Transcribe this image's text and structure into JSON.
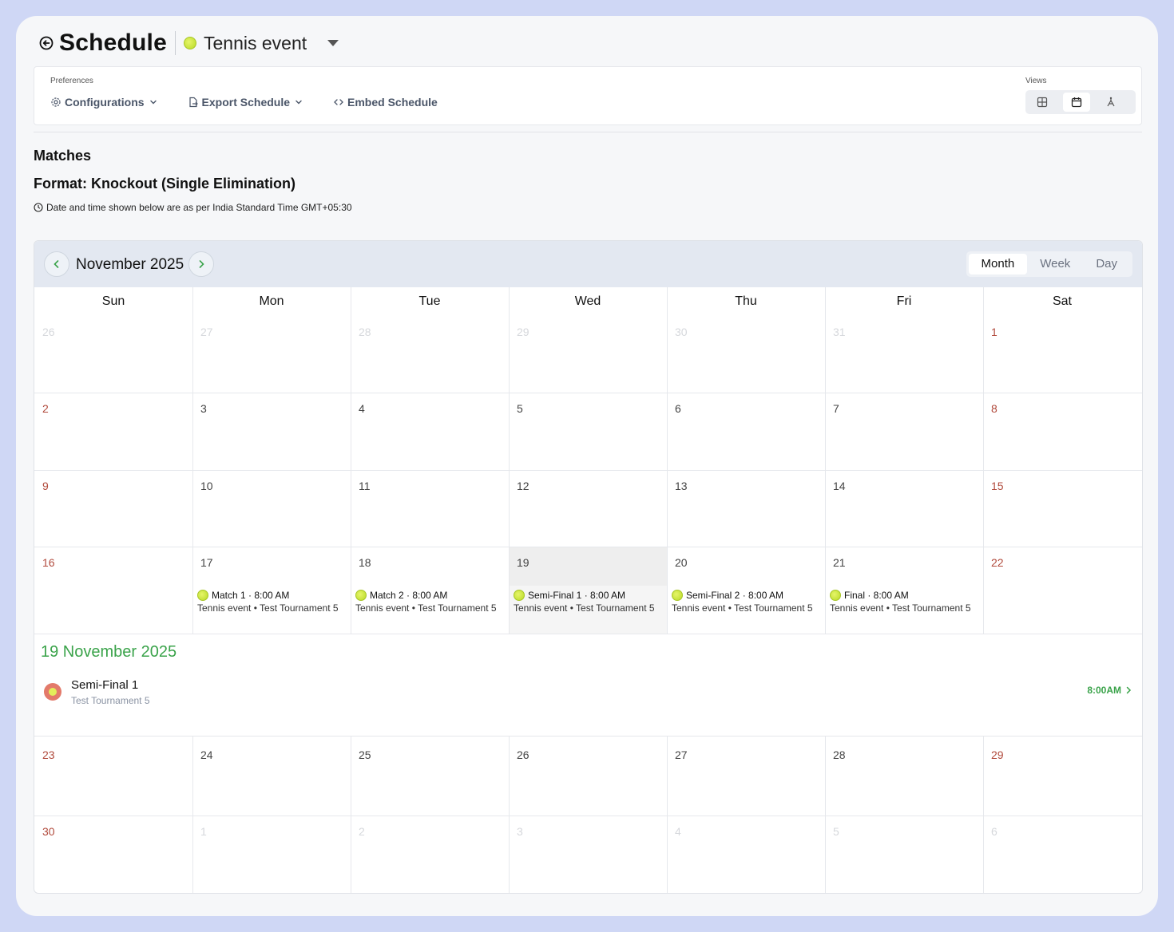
{
  "header": {
    "title": "Schedule",
    "event_name": "Tennis event"
  },
  "preferences": {
    "label": "Preferences",
    "configurations": "Configurations",
    "export": "Export Schedule",
    "embed": "Embed Schedule",
    "views_label": "Views"
  },
  "section": {
    "title": "Matches",
    "format": "Format: Knockout (Single Elimination)",
    "timezone_note": "Date and time shown below are as per India Standard Time GMT+05:30"
  },
  "calendar": {
    "month_title": "November 2025",
    "tabs": [
      "Month",
      "Week",
      "Day"
    ],
    "active_tab": "Month",
    "weekdays": [
      "Sun",
      "Mon",
      "Tue",
      "Wed",
      "Thu",
      "Fri",
      "Sat"
    ],
    "weeks": [
      [
        "26",
        "27",
        "28",
        "29",
        "30",
        "31",
        "1"
      ],
      [
        "2",
        "3",
        "4",
        "5",
        "6",
        "7",
        "8"
      ],
      [
        "9",
        "10",
        "11",
        "12",
        "13",
        "14",
        "15"
      ],
      [
        "16",
        "17",
        "18",
        "19",
        "20",
        "21",
        "22"
      ],
      [
        "23",
        "24",
        "25",
        "26",
        "27",
        "28",
        "29"
      ],
      [
        "30",
        "1",
        "2",
        "3",
        "4",
        "5",
        "6"
      ]
    ],
    "events": [
      {
        "title": "Match 1 · 8:00 AM",
        "sub": "Tennis event • Test Tournament 5"
      },
      {
        "title": "Match 2 · 8:00 AM",
        "sub": "Tennis event • Test Tournament 5"
      },
      {
        "title": "Semi-Final 1 · 8:00 AM",
        "sub": "Tennis event • Test Tournament 5"
      },
      {
        "title": "Semi-Final 2 · 8:00 AM",
        "sub": "Tennis event • Test Tournament 5"
      },
      {
        "title": "Final · 8:00 AM",
        "sub": "Tennis event • Test Tournament 5"
      }
    ],
    "detail": {
      "date": "19 November 2025",
      "name": "Semi-Final 1",
      "tournament": "Test Tournament 5",
      "time": "8:00AM"
    }
  },
  "colors": {
    "accent_green": "#3aa34a",
    "weekend_red": "#b14a3c",
    "page_bg": "#cfd7f5"
  }
}
